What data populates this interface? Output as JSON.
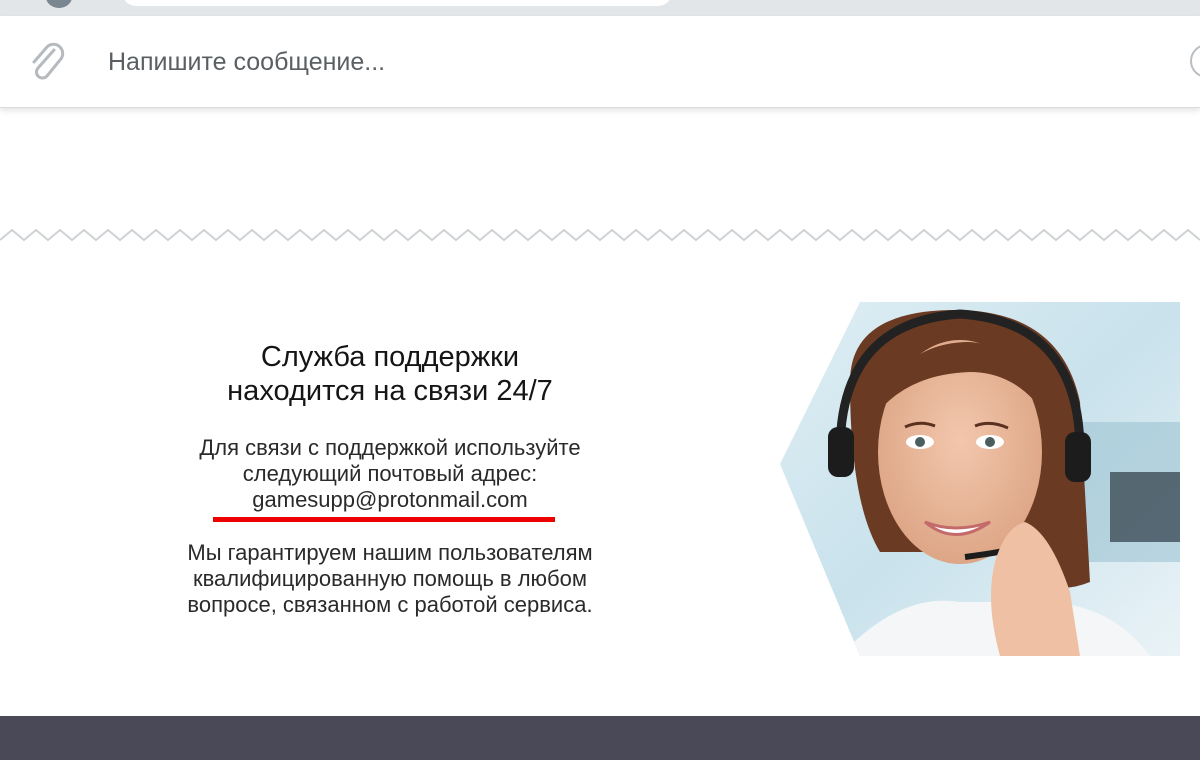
{
  "composer": {
    "placeholder": "Напишите сообщение..."
  },
  "support": {
    "title_line1": "Служба поддержки",
    "title_line2": "находится на связи 24/7",
    "contact_line1": "Для связи с поддержкой используйте",
    "contact_line2": "следующий почтовый адрес:",
    "email": "gamesupp@protonmail.com",
    "guarantee_line1": "Мы гарантируем нашим пользователям",
    "guarantee_line2": "квалифицированную помощь в любом",
    "guarantee_line3": "вопросе, связанном с работой сервиса."
  },
  "colors": {
    "highlight_underline": "#ee0000",
    "footer": "#4a4957",
    "composer_text": "#5a5f63"
  }
}
